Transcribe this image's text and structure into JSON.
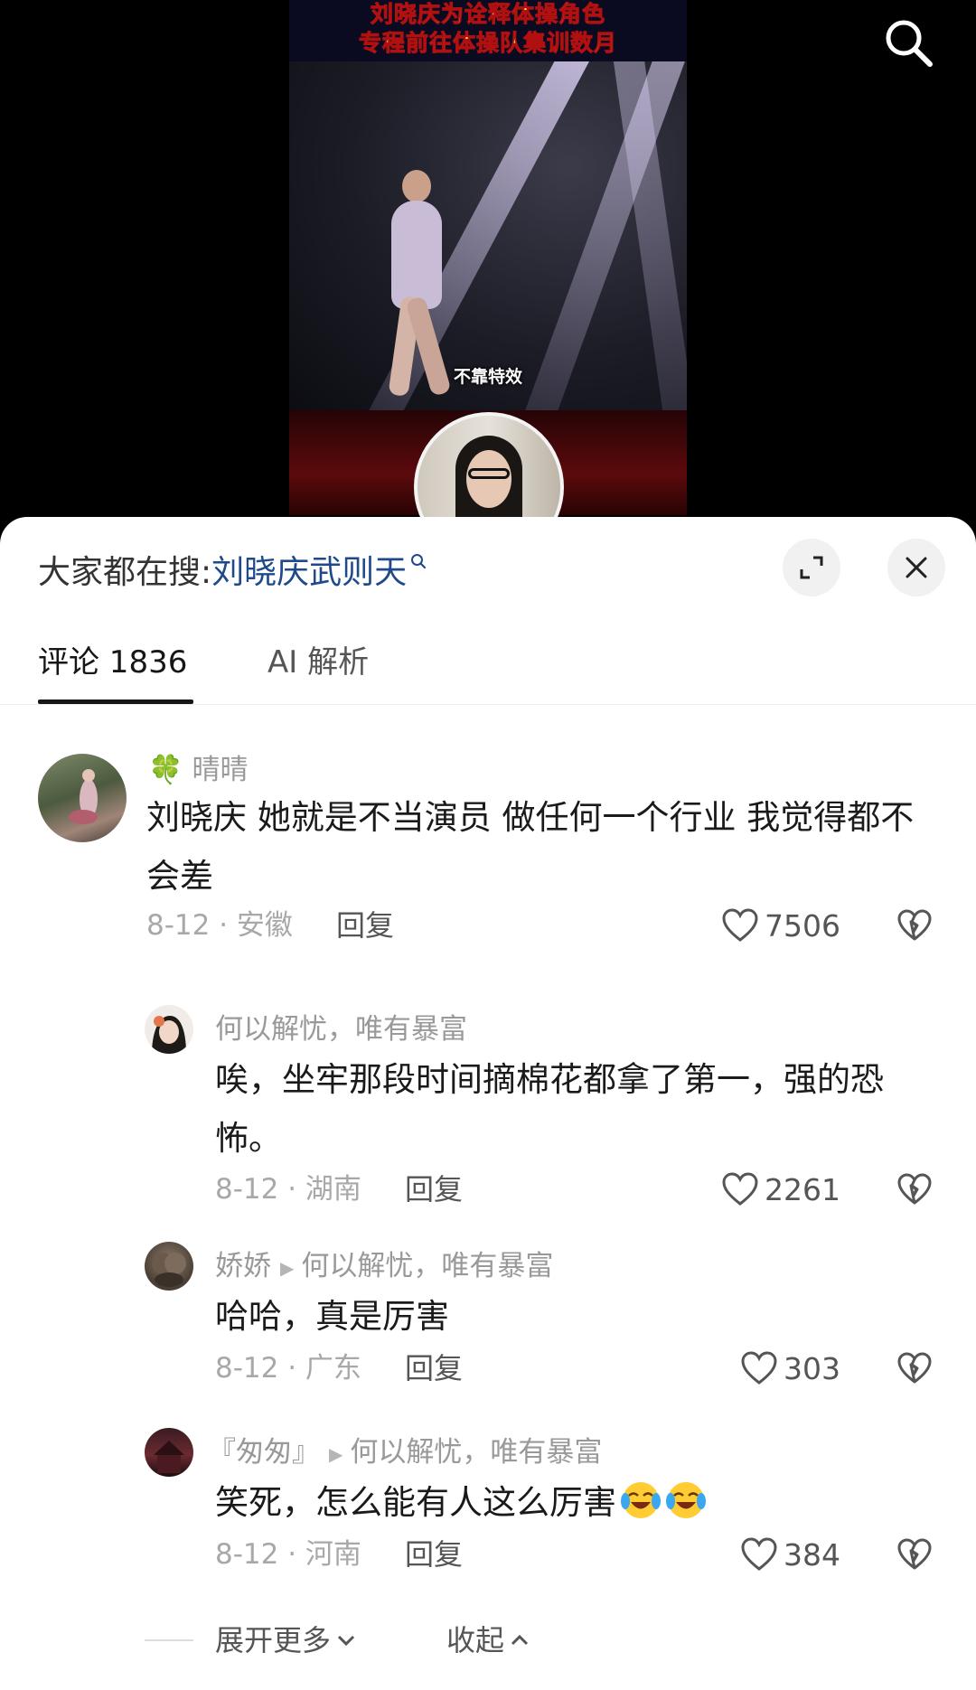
{
  "video": {
    "caption_line1": "刘晓庆为诠释体操角色",
    "caption_line2": "专程前往体操队集训数月",
    "subtitle": "不靠特效"
  },
  "hot_search": {
    "prefix": "大家都在搜:",
    "query": "刘晓庆武则天"
  },
  "tabs": {
    "comments": "评论 1836",
    "ai": "AI 解析"
  },
  "comments": [
    {
      "user": "晴晴",
      "user_emoji": "🍀",
      "text": "刘晓庆 她就是不当演员 做任何一个行业 我觉得都不会差",
      "date_location": "8-12 · 安徽",
      "reply": "回复",
      "likes": "7506"
    },
    {
      "user": "何以解忧，唯有暴富",
      "text": "唉，坐牢那段时间摘棉花都拿了第一，强的恐怖。",
      "date_location": "8-12 · 湖南",
      "reply": "回复",
      "likes": "2261"
    },
    {
      "user": "娇娇",
      "reply_to": "何以解忧，唯有暴富",
      "text": "哈哈，真是厉害",
      "date_location": "8-12 · 广东",
      "reply": "回复",
      "likes": "303"
    },
    {
      "user": "『匆匆』",
      "reply_to": "何以解忧，唯有暴富",
      "text": "笑死，怎么能有人这么厉害",
      "date_location": "8-12 · 河南",
      "reply": "回复",
      "likes": "384"
    }
  ],
  "footer": {
    "expand_more": "展开更多",
    "collapse": "收起"
  },
  "colors": {
    "link": "#1e4a8c",
    "text": "#1a1a1a",
    "muted": "#a8a8a8",
    "caption_yellow": "#ffe45c"
  }
}
